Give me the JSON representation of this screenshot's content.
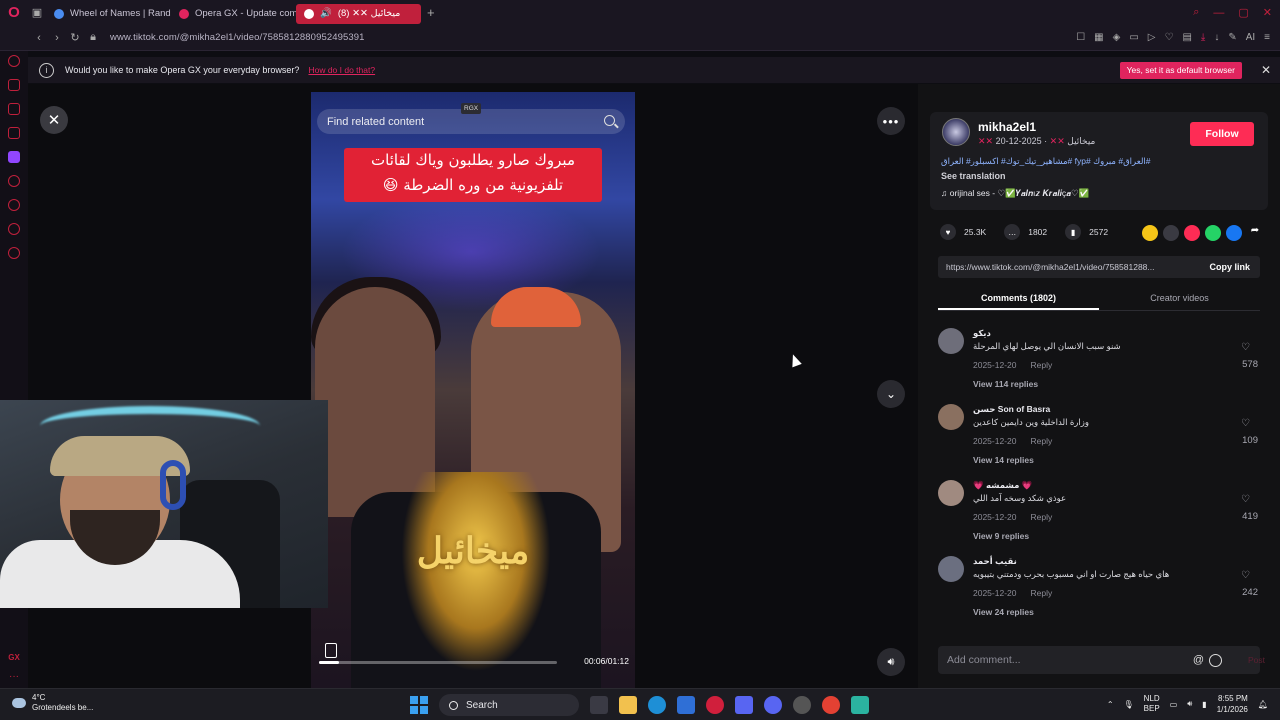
{
  "browser": {
    "tabs": [
      {
        "label": "Wheel of Names | Random",
        "fav_color": "#4a8cf0"
      },
      {
        "label": "Opera GX - Update comp",
        "fav_color": "#e0245e"
      },
      {
        "label": "(8) ✕✕ ميخائيل",
        "fav_color": "#ffffff"
      }
    ],
    "url": "www.tiktok.com/@mikha2el1/video/7585812880952495391",
    "ai_label": "AI"
  },
  "banner": {
    "message": "Would you like to make Opera GX your everyday browser?",
    "how_link": "How do I do that?",
    "default_button": "Yes, set it as default browser"
  },
  "video": {
    "search_placeholder": "Find related content",
    "rgx_label": "RGX",
    "caption_line1": "مبروك صارو يطلبون وياك لقائات",
    "caption_line2": "تلفزيونية من وره الضرطة 😆",
    "crest_text": "ميخائيل",
    "time": "00:06/01:12",
    "progress": 0.083
  },
  "post": {
    "username": "mikha2el1",
    "display_name": "ميخائيل",
    "date": "2025-12-20",
    "follow_label": "Follow",
    "description": "مشاهير_تيك_توك# اكسبلور# العراق# fyp# العراق# مبروك#",
    "see_translation": "See translation",
    "sound": "orijinal ses - ♡✅𝒀𝒂𝒍𝒏ı𝒛 𝑲𝒓𝒂𝒍𝒊ç𝒂♡✅",
    "likes": "25.3K",
    "comments_count": "1802",
    "saves": "2572",
    "link": "https://www.tiktok.com/@mikha2el1/video/758581288...",
    "copy_link": "Copy link"
  },
  "tabs": {
    "comments": "Comments (1802)",
    "creator": "Creator videos"
  },
  "comments": [
    {
      "name": "ديكو",
      "text": "شنو سبب الانسان الي يوصل لهاي المرحلة",
      "date": "2025-12-20",
      "reply": "Reply",
      "replies": "View 114 replies",
      "likes": "578"
    },
    {
      "name": "حسن Son of Basra",
      "text": "وزارة الداخلية وين دايمين كاعدين",
      "date": "2025-12-20",
      "reply": "Reply",
      "replies": "View 14 replies",
      "likes": "109"
    },
    {
      "name": "💗 مشمشه 💗",
      "text": "عوذي شكد وسخه آمد اللي",
      "date": "2025-12-20",
      "reply": "Reply",
      "replies": "View 9 replies",
      "likes": "419"
    },
    {
      "name": "نقيب أحمد",
      "text": "هاي حياه هيج صارت او اني مسبوب بحرب ودمتني بتيبويه",
      "date": "2025-12-20",
      "reply": "Reply",
      "replies": "View 24 replies",
      "likes": "242"
    }
  ],
  "add_comment": {
    "placeholder": "Add comment...",
    "post_label": "Post"
  },
  "taskbar": {
    "temp": "4°C",
    "weather": "Grotendeels be...",
    "search": "Search",
    "lang1": "NLD",
    "lang2": "BEP",
    "time": "8:55 PM",
    "date": "1/1/2026"
  }
}
